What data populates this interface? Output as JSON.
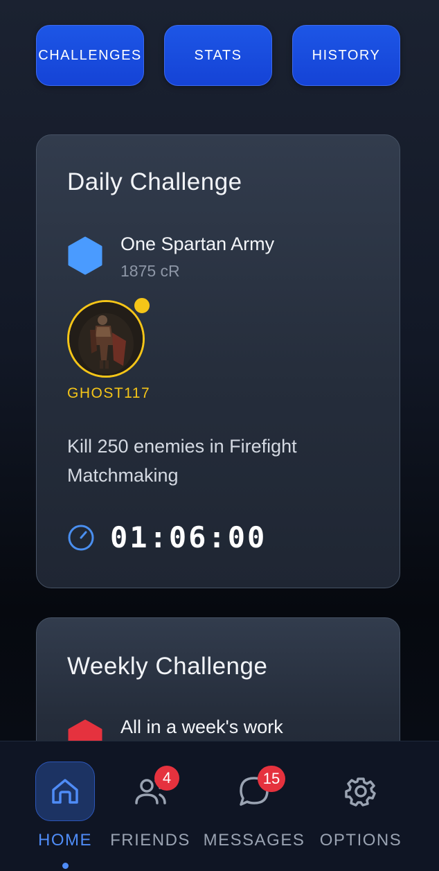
{
  "tabs": [
    {
      "label": "CHALLENGES"
    },
    {
      "label": "STATS"
    },
    {
      "label": "HISTORY"
    }
  ],
  "daily": {
    "title": "Daily Challenge",
    "challenge_name": "One Spartan Army",
    "reward": "1875 cR",
    "hex_color": "#4a9bff",
    "gamertag": "GHOST117",
    "description": "Kill 250 enemies in Firefight Matchmaking",
    "timer": "01:06:00"
  },
  "weekly": {
    "title": "Weekly Challenge",
    "challenge_name": "All in a week's work",
    "hex_color": "#e5323e"
  },
  "nav": {
    "items": [
      {
        "label": "HOME",
        "icon": "home-icon",
        "active": true
      },
      {
        "label": "FRIENDS",
        "icon": "friends-icon",
        "badge": "4"
      },
      {
        "label": "MESSAGES",
        "icon": "messages-icon",
        "badge": "15"
      },
      {
        "label": "OPTIONS",
        "icon": "gear-icon"
      }
    ]
  },
  "colors": {
    "accent": "#1d56e6",
    "active_nav": "#4f8cf7",
    "gamertag": "#f5c518",
    "badge": "#e5323e"
  }
}
